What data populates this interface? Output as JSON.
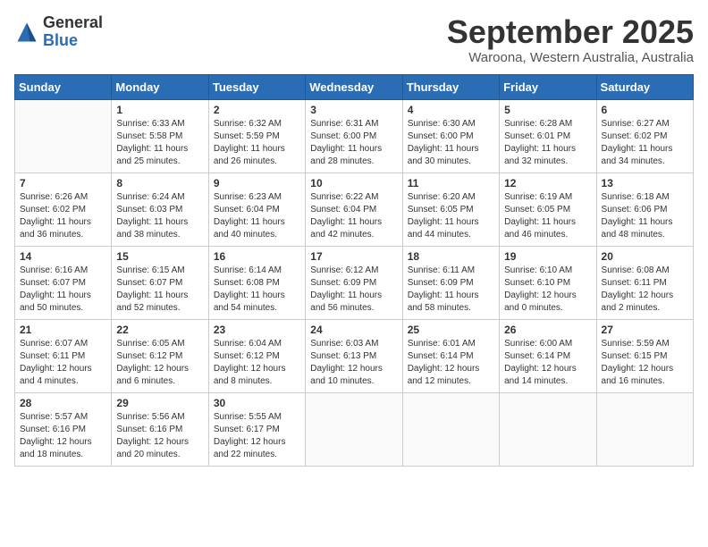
{
  "header": {
    "logo_general": "General",
    "logo_blue": "Blue",
    "month_title": "September 2025",
    "location": "Waroona, Western Australia, Australia"
  },
  "days_of_week": [
    "Sunday",
    "Monday",
    "Tuesday",
    "Wednesday",
    "Thursday",
    "Friday",
    "Saturday"
  ],
  "weeks": [
    [
      {
        "num": "",
        "info": ""
      },
      {
        "num": "1",
        "info": "Sunrise: 6:33 AM\nSunset: 5:58 PM\nDaylight: 11 hours\nand 25 minutes."
      },
      {
        "num": "2",
        "info": "Sunrise: 6:32 AM\nSunset: 5:59 PM\nDaylight: 11 hours\nand 26 minutes."
      },
      {
        "num": "3",
        "info": "Sunrise: 6:31 AM\nSunset: 6:00 PM\nDaylight: 11 hours\nand 28 minutes."
      },
      {
        "num": "4",
        "info": "Sunrise: 6:30 AM\nSunset: 6:00 PM\nDaylight: 11 hours\nand 30 minutes."
      },
      {
        "num": "5",
        "info": "Sunrise: 6:28 AM\nSunset: 6:01 PM\nDaylight: 11 hours\nand 32 minutes."
      },
      {
        "num": "6",
        "info": "Sunrise: 6:27 AM\nSunset: 6:02 PM\nDaylight: 11 hours\nand 34 minutes."
      }
    ],
    [
      {
        "num": "7",
        "info": "Sunrise: 6:26 AM\nSunset: 6:02 PM\nDaylight: 11 hours\nand 36 minutes."
      },
      {
        "num": "8",
        "info": "Sunrise: 6:24 AM\nSunset: 6:03 PM\nDaylight: 11 hours\nand 38 minutes."
      },
      {
        "num": "9",
        "info": "Sunrise: 6:23 AM\nSunset: 6:04 PM\nDaylight: 11 hours\nand 40 minutes."
      },
      {
        "num": "10",
        "info": "Sunrise: 6:22 AM\nSunset: 6:04 PM\nDaylight: 11 hours\nand 42 minutes."
      },
      {
        "num": "11",
        "info": "Sunrise: 6:20 AM\nSunset: 6:05 PM\nDaylight: 11 hours\nand 44 minutes."
      },
      {
        "num": "12",
        "info": "Sunrise: 6:19 AM\nSunset: 6:05 PM\nDaylight: 11 hours\nand 46 minutes."
      },
      {
        "num": "13",
        "info": "Sunrise: 6:18 AM\nSunset: 6:06 PM\nDaylight: 11 hours\nand 48 minutes."
      }
    ],
    [
      {
        "num": "14",
        "info": "Sunrise: 6:16 AM\nSunset: 6:07 PM\nDaylight: 11 hours\nand 50 minutes."
      },
      {
        "num": "15",
        "info": "Sunrise: 6:15 AM\nSunset: 6:07 PM\nDaylight: 11 hours\nand 52 minutes."
      },
      {
        "num": "16",
        "info": "Sunrise: 6:14 AM\nSunset: 6:08 PM\nDaylight: 11 hours\nand 54 minutes."
      },
      {
        "num": "17",
        "info": "Sunrise: 6:12 AM\nSunset: 6:09 PM\nDaylight: 11 hours\nand 56 minutes."
      },
      {
        "num": "18",
        "info": "Sunrise: 6:11 AM\nSunset: 6:09 PM\nDaylight: 11 hours\nand 58 minutes."
      },
      {
        "num": "19",
        "info": "Sunrise: 6:10 AM\nSunset: 6:10 PM\nDaylight: 12 hours\nand 0 minutes."
      },
      {
        "num": "20",
        "info": "Sunrise: 6:08 AM\nSunset: 6:11 PM\nDaylight: 12 hours\nand 2 minutes."
      }
    ],
    [
      {
        "num": "21",
        "info": "Sunrise: 6:07 AM\nSunset: 6:11 PM\nDaylight: 12 hours\nand 4 minutes."
      },
      {
        "num": "22",
        "info": "Sunrise: 6:05 AM\nSunset: 6:12 PM\nDaylight: 12 hours\nand 6 minutes."
      },
      {
        "num": "23",
        "info": "Sunrise: 6:04 AM\nSunset: 6:12 PM\nDaylight: 12 hours\nand 8 minutes."
      },
      {
        "num": "24",
        "info": "Sunrise: 6:03 AM\nSunset: 6:13 PM\nDaylight: 12 hours\nand 10 minutes."
      },
      {
        "num": "25",
        "info": "Sunrise: 6:01 AM\nSunset: 6:14 PM\nDaylight: 12 hours\nand 12 minutes."
      },
      {
        "num": "26",
        "info": "Sunrise: 6:00 AM\nSunset: 6:14 PM\nDaylight: 12 hours\nand 14 minutes."
      },
      {
        "num": "27",
        "info": "Sunrise: 5:59 AM\nSunset: 6:15 PM\nDaylight: 12 hours\nand 16 minutes."
      }
    ],
    [
      {
        "num": "28",
        "info": "Sunrise: 5:57 AM\nSunset: 6:16 PM\nDaylight: 12 hours\nand 18 minutes."
      },
      {
        "num": "29",
        "info": "Sunrise: 5:56 AM\nSunset: 6:16 PM\nDaylight: 12 hours\nand 20 minutes."
      },
      {
        "num": "30",
        "info": "Sunrise: 5:55 AM\nSunset: 6:17 PM\nDaylight: 12 hours\nand 22 minutes."
      },
      {
        "num": "",
        "info": ""
      },
      {
        "num": "",
        "info": ""
      },
      {
        "num": "",
        "info": ""
      },
      {
        "num": "",
        "info": ""
      }
    ]
  ]
}
